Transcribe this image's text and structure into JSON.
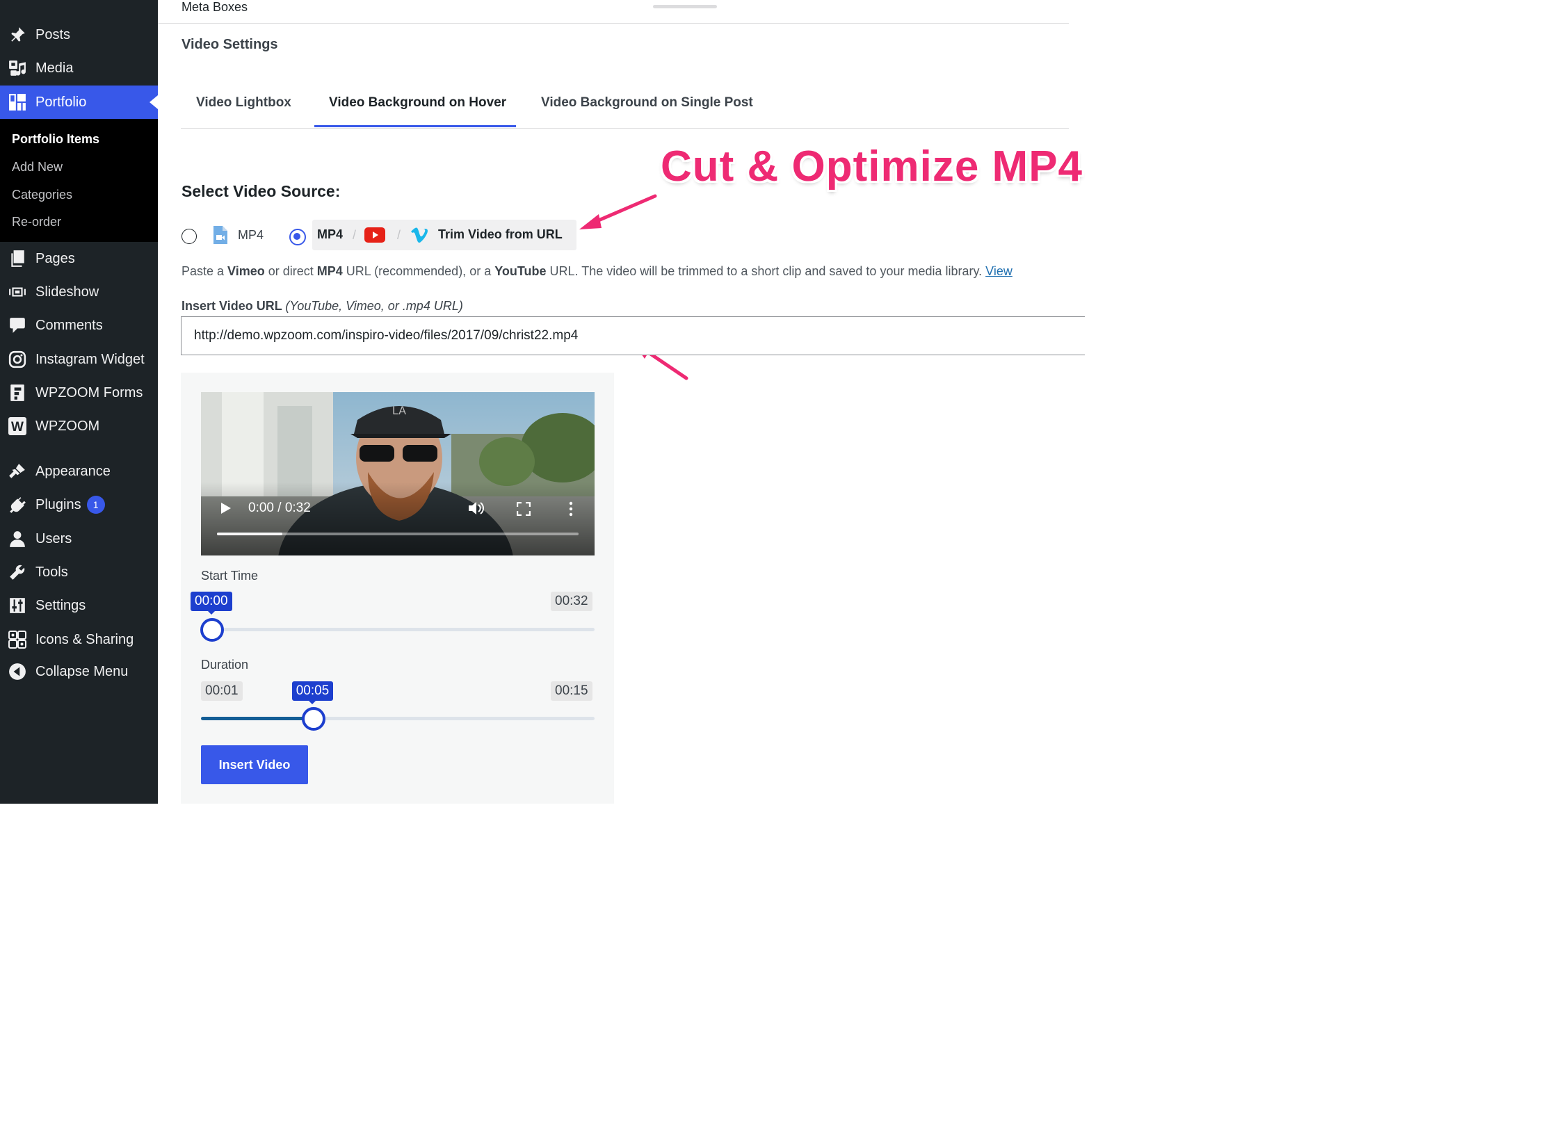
{
  "sidebar": {
    "items": [
      {
        "label": "Posts",
        "icon": "pin-icon"
      },
      {
        "label": "Media",
        "icon": "media-icon"
      },
      {
        "label": "Portfolio",
        "icon": "portfolio-icon"
      },
      {
        "label": "Pages",
        "icon": "pages-icon"
      },
      {
        "label": "Slideshow",
        "icon": "slideshow-icon"
      },
      {
        "label": "Comments",
        "icon": "comment-icon"
      },
      {
        "label": "Instagram Widget",
        "icon": "instagram-icon"
      },
      {
        "label": "WPZOOM Forms",
        "icon": "forms-icon"
      },
      {
        "label": "WPZOOM",
        "icon": "wpzoom-icon"
      },
      {
        "label": "Appearance",
        "icon": "brush-icon"
      },
      {
        "label": "Plugins",
        "icon": "plug-icon",
        "badge": "1"
      },
      {
        "label": "Users",
        "icon": "user-icon"
      },
      {
        "label": "Tools",
        "icon": "wrench-icon"
      },
      {
        "label": "Settings",
        "icon": "settings-icon"
      },
      {
        "label": "Icons & Sharing",
        "icon": "share-icon"
      },
      {
        "label": "Collapse Menu",
        "icon": "collapse-icon"
      }
    ],
    "submenu": [
      "Portfolio Items",
      "Add New",
      "Categories",
      "Re-order"
    ],
    "wpzoom_glyph": "W",
    "accent": "#3858e9"
  },
  "metabox": {
    "title": "Meta Boxes",
    "section_title": "Video Settings",
    "tabs": [
      "Video Lightbox",
      "Video Background on Hover",
      "Video Background on Single Post"
    ],
    "active_tab": "Video Background on Hover"
  },
  "source": {
    "heading": "Select Video Source:",
    "option_mp4": "MP4",
    "option_trim_mp4": "MP4",
    "option_trim_label": "Trim Video from URL",
    "separator": "/",
    "selected": "Trim Video from URL"
  },
  "help": {
    "p1": "Paste a ",
    "b1": "Vimeo",
    "p2": " or direct ",
    "b2": "MP4",
    "p3": " URL (recommended), or a ",
    "b3": "YouTube",
    "p4": " URL. The video will be trimmed to a short clip and saved to your media library. ",
    "link": "View"
  },
  "url_field": {
    "label": "Insert Video URL",
    "hint": "(YouTube, Vimeo, or .mp4 URL)",
    "value": "http://demo.wpzoom.com/inspiro-video/files/2017/09/christ22.mp4"
  },
  "player": {
    "time": "0:00 / 0:32",
    "cap_text": "LA",
    "progress": 0.18
  },
  "trim": {
    "start_label": "Start Time",
    "start_value": "00:00",
    "start_max": "00:32",
    "start_fraction": 0.0,
    "duration_label": "Duration",
    "duration_min": "00:01",
    "duration_value": "00:05",
    "duration_max": "00:15",
    "duration_fraction": 0.2857,
    "slider_color": "#1d3fce"
  },
  "actions": {
    "insert": "Insert Video"
  },
  "annotation": {
    "text": "Cut & Optimize MP4",
    "color": "#ee2a73"
  }
}
